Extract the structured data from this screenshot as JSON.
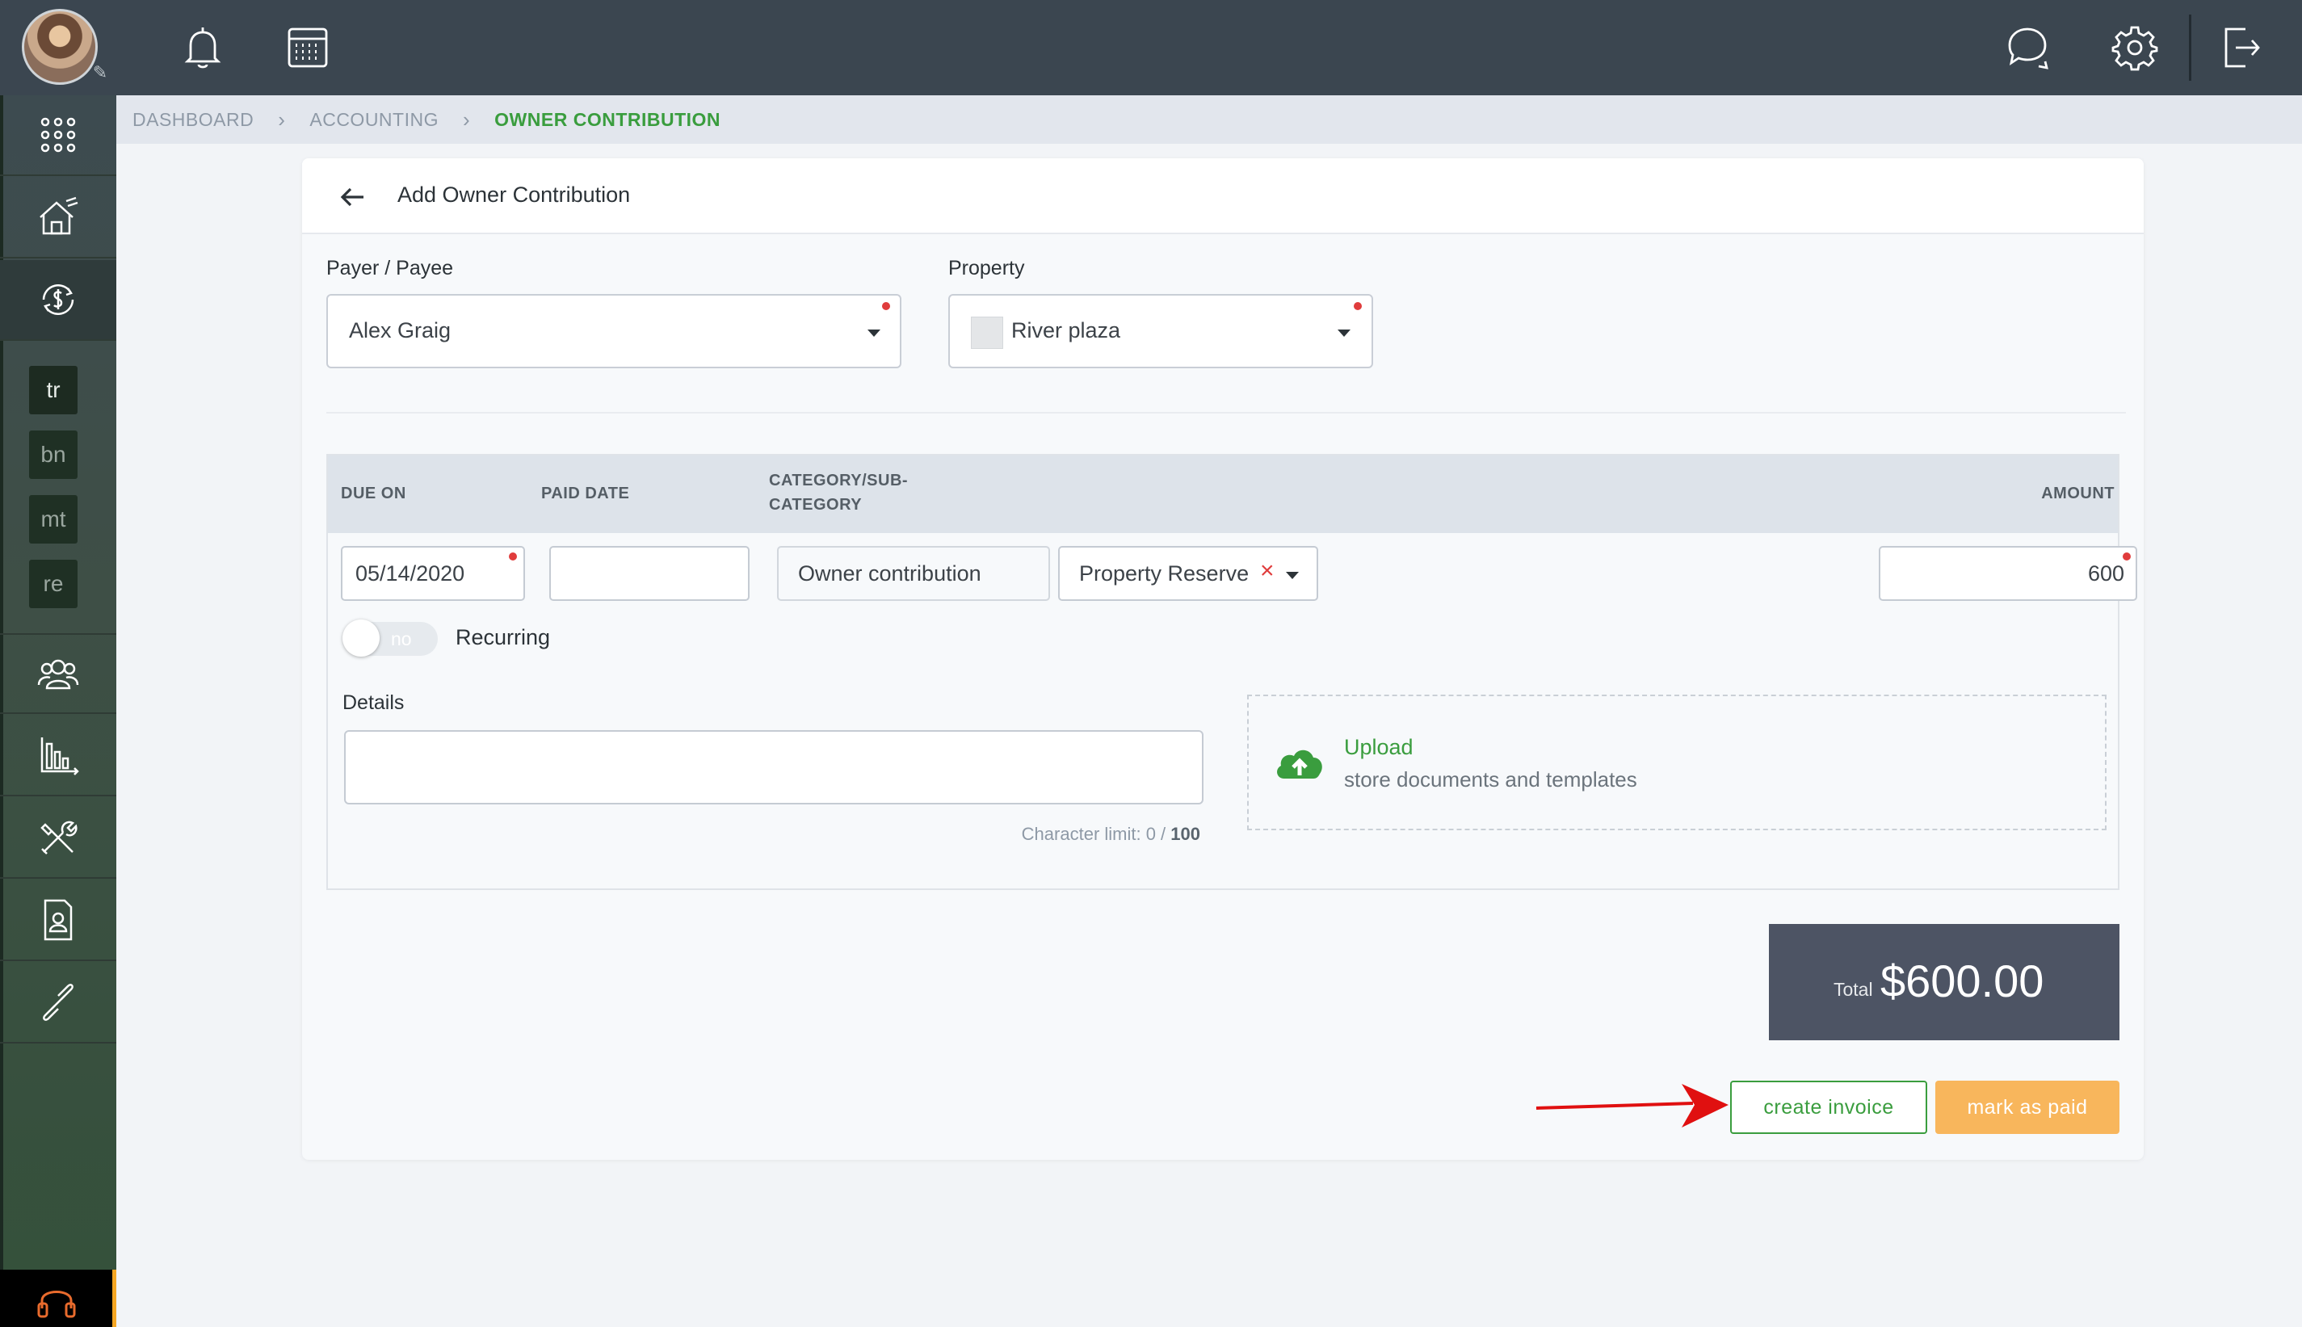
{
  "sidebar": {
    "items": [
      {
        "name": "apps-icon"
      },
      {
        "name": "properties-icon"
      },
      {
        "name": "accounting-icon"
      },
      {
        "name": "contacts-icon"
      },
      {
        "name": "reports-icon"
      },
      {
        "name": "maintenance-icon"
      },
      {
        "name": "documents-icon"
      },
      {
        "name": "links-icon"
      }
    ],
    "shortcuts": [
      "tr",
      "bn",
      "mt",
      "re"
    ],
    "support": "headset-icon"
  },
  "topbar": {
    "icons": [
      "bell-icon",
      "calendar-icon",
      "chat-icon",
      "gear-icon",
      "logout-icon"
    ]
  },
  "breadcrumb": {
    "items": [
      "DASHBOARD",
      "ACCOUNTING"
    ],
    "current": "OWNER CONTRIBUTION"
  },
  "form": {
    "title": "Add Owner Contribution",
    "payer_label": "Payer / Payee",
    "payer_value": "Alex Graig",
    "property_label": "Property",
    "property_value": "River plaza",
    "table": {
      "headers": {
        "due_on": "DUE ON",
        "paid_date": "PAID DATE",
        "category_line1": "CATEGORY/SUB-",
        "category_line2": "CATEGORY",
        "amount": "AMOUNT"
      },
      "row": {
        "due_on": "05/14/2020",
        "paid_date": "",
        "category": "Owner contribution",
        "subcategory": "Property Reserve",
        "amount": "600"
      }
    },
    "recurring": {
      "toggle_text": "no",
      "label": "Recurring"
    },
    "details": {
      "label": "Details",
      "value": "",
      "char_limit_prefix": "Character limit: 0 / ",
      "char_limit_max": "100"
    },
    "upload": {
      "title": "Upload",
      "subtitle": "store documents and templates"
    },
    "total": {
      "label": "Total",
      "value": "$600.00"
    },
    "buttons": {
      "create_invoice": "create invoice",
      "mark_as_paid": "mark as paid"
    }
  },
  "colors": {
    "accent_green": "#3a9d3e",
    "button_orange": "#f8b65c",
    "required_red": "#e03c3c",
    "annotation_arrow": "#e01010"
  }
}
